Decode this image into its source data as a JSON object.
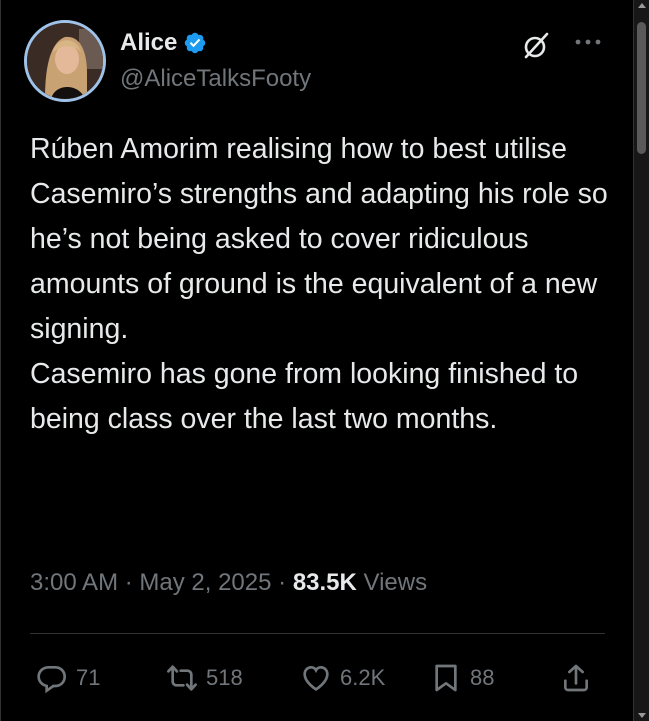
{
  "author": {
    "name": "Alice",
    "handle": "@AliceTalksFooty",
    "verified": true,
    "avatar_icon": "profile-photo"
  },
  "header_icons": [
    "grok-icon",
    "more-icon"
  ],
  "tweet": {
    "paragraphs": [
      "Rúben Amorim realising how to best utilise Casemiro’s strengths and adapting his role so he’s not being asked to cover ridiculous amounts of ground is the equivalent of a new signing.",
      "Casemiro has gone from looking finished to being class over the last two months."
    ]
  },
  "meta": {
    "time": "3:00 AM",
    "sep1": " · ",
    "date": "May 2, 2025",
    "sep2": " · ",
    "views_count": "83.5K",
    "views_label": " Views"
  },
  "actions": {
    "replies": "71",
    "reposts": "518",
    "likes": "6.2K",
    "bookmarks": "88"
  },
  "colors": {
    "background": "#000000",
    "text": "#e7e9ea",
    "muted": "#71767b",
    "verified": "#1d9bf0",
    "divider": "#2f3336"
  }
}
